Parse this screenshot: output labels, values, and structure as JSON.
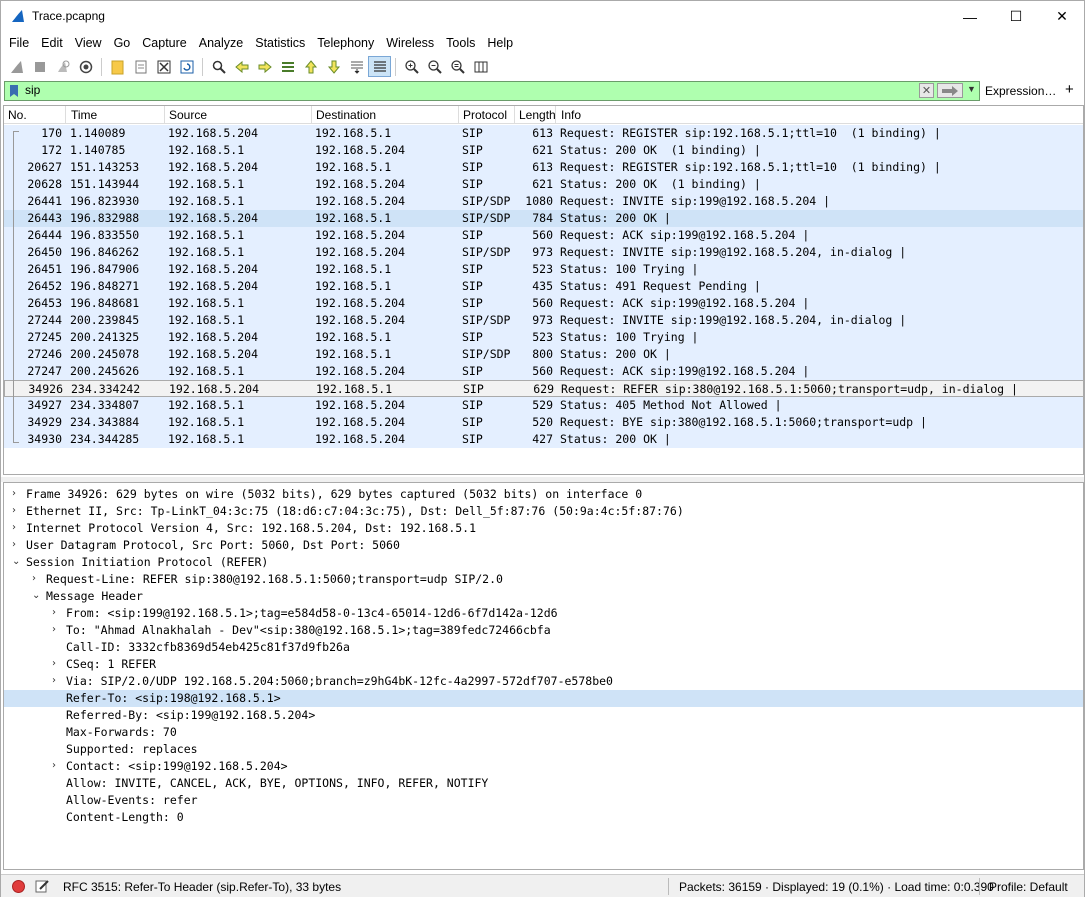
{
  "window": {
    "title": "Trace.pcapng"
  },
  "menu": [
    "File",
    "Edit",
    "View",
    "Go",
    "Capture",
    "Analyze",
    "Statistics",
    "Telephony",
    "Wireless",
    "Tools",
    "Help"
  ],
  "filter": {
    "value": "sip",
    "expression_label": "Expression…",
    "add_label": "+"
  },
  "columns": {
    "no": "No.",
    "time": "Time",
    "source": "Source",
    "destination": "Destination",
    "protocol": "Protocol",
    "length": "Length",
    "info": "Info"
  },
  "packets": [
    {
      "no": "170",
      "time": "1.140089",
      "src": "192.168.5.204",
      "dst": "192.168.5.1",
      "proto": "SIP",
      "len": "613",
      "info": "Request: REGISTER sip:192.168.5.1;ttl=10  (1 binding) |"
    },
    {
      "no": "172",
      "time": "1.140785",
      "src": "192.168.5.1",
      "dst": "192.168.5.204",
      "proto": "SIP",
      "len": "621",
      "info": "Status: 200 OK  (1 binding) |"
    },
    {
      "no": "20627",
      "time": "151.143253",
      "src": "192.168.5.204",
      "dst": "192.168.5.1",
      "proto": "SIP",
      "len": "613",
      "info": "Request: REGISTER sip:192.168.5.1;ttl=10  (1 binding) |"
    },
    {
      "no": "20628",
      "time": "151.143944",
      "src": "192.168.5.1",
      "dst": "192.168.5.204",
      "proto": "SIP",
      "len": "621",
      "info": "Status: 200 OK  (1 binding) |"
    },
    {
      "no": "26441",
      "time": "196.823930",
      "src": "192.168.5.1",
      "dst": "192.168.5.204",
      "proto": "SIP/SDP",
      "len": "1080",
      "info": "Request: INVITE sip:199@192.168.5.204 |"
    },
    {
      "no": "26443",
      "time": "196.832988",
      "src": "192.168.5.204",
      "dst": "192.168.5.1",
      "proto": "SIP/SDP",
      "len": "784",
      "info": "Status: 200 OK |"
    },
    {
      "no": "26444",
      "time": "196.833550",
      "src": "192.168.5.1",
      "dst": "192.168.5.204",
      "proto": "SIP",
      "len": "560",
      "info": "Request: ACK sip:199@192.168.5.204 |"
    },
    {
      "no": "26450",
      "time": "196.846262",
      "src": "192.168.5.1",
      "dst": "192.168.5.204",
      "proto": "SIP/SDP",
      "len": "973",
      "info": "Request: INVITE sip:199@192.168.5.204, in-dialog |"
    },
    {
      "no": "26451",
      "time": "196.847906",
      "src": "192.168.5.204",
      "dst": "192.168.5.1",
      "proto": "SIP",
      "len": "523",
      "info": "Status: 100 Trying |"
    },
    {
      "no": "26452",
      "time": "196.848271",
      "src": "192.168.5.204",
      "dst": "192.168.5.1",
      "proto": "SIP",
      "len": "435",
      "info": "Status: 491 Request Pending |"
    },
    {
      "no": "26453",
      "time": "196.848681",
      "src": "192.168.5.1",
      "dst": "192.168.5.204",
      "proto": "SIP",
      "len": "560",
      "info": "Request: ACK sip:199@192.168.5.204 |"
    },
    {
      "no": "27244",
      "time": "200.239845",
      "src": "192.168.5.1",
      "dst": "192.168.5.204",
      "proto": "SIP/SDP",
      "len": "973",
      "info": "Request: INVITE sip:199@192.168.5.204, in-dialog |"
    },
    {
      "no": "27245",
      "time": "200.241325",
      "src": "192.168.5.204",
      "dst": "192.168.5.1",
      "proto": "SIP",
      "len": "523",
      "info": "Status: 100 Trying |"
    },
    {
      "no": "27246",
      "time": "200.245078",
      "src": "192.168.5.204",
      "dst": "192.168.5.1",
      "proto": "SIP/SDP",
      "len": "800",
      "info": "Status: 200 OK |"
    },
    {
      "no": "27247",
      "time": "200.245626",
      "src": "192.168.5.1",
      "dst": "192.168.5.204",
      "proto": "SIP",
      "len": "560",
      "info": "Request: ACK sip:199@192.168.5.204 |"
    },
    {
      "no": "34926",
      "time": "234.334242",
      "src": "192.168.5.204",
      "dst": "192.168.5.1",
      "proto": "SIP",
      "len": "629",
      "info": "Request: REFER sip:380@192.168.5.1:5060;transport=udp, in-dialog |"
    },
    {
      "no": "34927",
      "time": "234.334807",
      "src": "192.168.5.1",
      "dst": "192.168.5.204",
      "proto": "SIP",
      "len": "529",
      "info": "Status: 405 Method Not Allowed |"
    },
    {
      "no": "34929",
      "time": "234.343884",
      "src": "192.168.5.1",
      "dst": "192.168.5.204",
      "proto": "SIP",
      "len": "520",
      "info": "Request: BYE sip:380@192.168.5.1:5060;transport=udp |"
    },
    {
      "no": "34930",
      "time": "234.344285",
      "src": "192.168.5.1",
      "dst": "192.168.5.204",
      "proto": "SIP",
      "len": "427",
      "info": "Status: 200 OK |"
    }
  ],
  "details": [
    {
      "arrow": ">",
      "text": "Frame 34926: 629 bytes on wire (5032 bits), 629 bytes captured (5032 bits) on interface 0"
    },
    {
      "arrow": ">",
      "text": "Ethernet II, Src: Tp-LinkT_04:3c:75 (18:d6:c7:04:3c:75), Dst: Dell_5f:87:76 (50:9a:4c:5f:87:76)"
    },
    {
      "arrow": ">",
      "text": "Internet Protocol Version 4, Src: 192.168.5.204, Dst: 192.168.5.1"
    },
    {
      "arrow": ">",
      "text": "User Datagram Protocol, Src Port: 5060, Dst Port: 5060"
    },
    {
      "arrow": "v",
      "text": "Session Initiation Protocol (REFER)"
    },
    {
      "arrow": ">",
      "text": "Request-Line: REFER sip:380@192.168.5.1:5060;transport=udp SIP/2.0"
    },
    {
      "arrow": "v",
      "text": "Message Header"
    },
    {
      "arrow": ">",
      "text": "From: <sip:199@192.168.5.1>;tag=e584d58-0-13c4-65014-12d6-6f7d142a-12d6"
    },
    {
      "arrow": ">",
      "text": "To: \"Ahmad Alnakhalah - Dev\"<sip:380@192.168.5.1>;tag=389fedc72466cbfa"
    },
    {
      "arrow": "",
      "text": "Call-ID: 3332cfb8369d54eb425c81f37d9fb26a"
    },
    {
      "arrow": ">",
      "text": "CSeq: 1 REFER"
    },
    {
      "arrow": ">",
      "text": "Via: SIP/2.0/UDP 192.168.5.204:5060;branch=z9hG4bK-12fc-4a2997-572df707-e578be0"
    },
    {
      "arrow": "",
      "text": "Refer-To: <sip:198@192.168.5.1>"
    },
    {
      "arrow": "",
      "text": "Referred-By: <sip:199@192.168.5.204>"
    },
    {
      "arrow": "",
      "text": "Max-Forwards: 70"
    },
    {
      "arrow": "",
      "text": "Supported: replaces"
    },
    {
      "arrow": ">",
      "text": "Contact: <sip:199@192.168.5.204>"
    },
    {
      "arrow": "",
      "text": "Allow: INVITE, CANCEL, ACK, BYE, OPTIONS, INFO, REFER, NOTIFY"
    },
    {
      "arrow": "",
      "text": "Allow-Events: refer"
    },
    {
      "arrow": "",
      "text": "Content-Length: 0"
    }
  ],
  "status": {
    "field_info": "RFC 3515: Refer-To Header (sip.Refer-To), 33 bytes",
    "packets": "Packets: 36159 · Displayed: 19 (0.1%) · Load time: 0:0.390",
    "profile": "Profile: Default"
  },
  "colors": {
    "filter_ok": "#afffaf",
    "row_bg": "#e4efff",
    "row_selected": "#cfe3f7"
  }
}
